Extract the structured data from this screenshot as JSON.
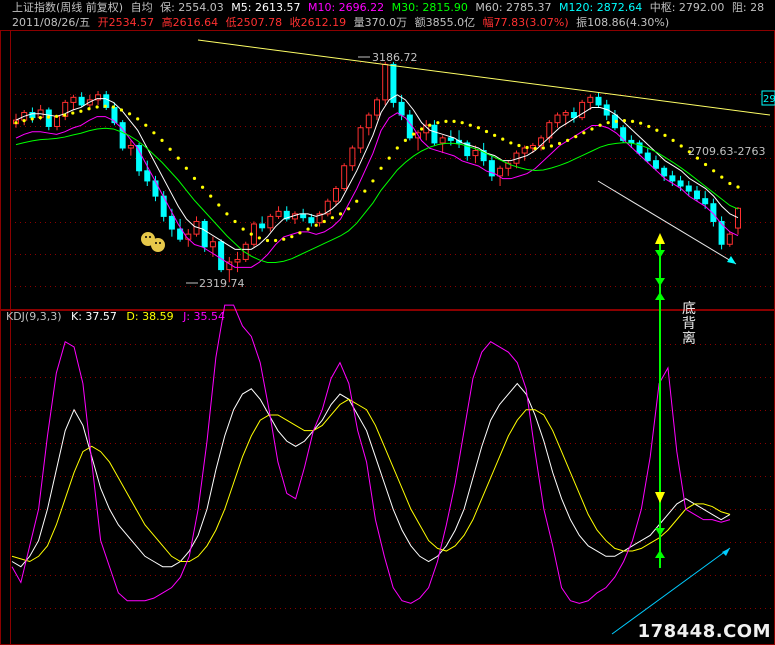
{
  "header": {
    "title": "上证指数(周线 前复权)",
    "avg_label": "自均",
    "bao": "保: 2554.03",
    "m5": "M5: 2613.57",
    "m10": "M10: 2696.22",
    "m30": "M30: 2815.90",
    "m60": "M60: 2785.37",
    "m120": "M120: 2872.64",
    "pivot": "中枢: 2792.00",
    "resist": "阻: 28",
    "date": "2011/08/26/五",
    "open": "开2534.57",
    "high": "高2616.64",
    "low": "低2507.78",
    "close": "收2612.19",
    "vol": "量370.0万",
    "amount": "额3855.0亿",
    "change": "幅77.83(3.07%)",
    "amplitude": "振108.86(4.30%)"
  },
  "kdj": {
    "title": "KDJ(9,3,3)",
    "k": "K: 37.57",
    "d": "D: 38.59",
    "j": "J: 35.54"
  },
  "annotations": {
    "high_label": "3186.72",
    "low_label": "2319.74",
    "right_label": "2709.63-2763",
    "edge_label": "29",
    "divergence": "底背离"
  },
  "watermark": "178448.COM",
  "colors": {
    "up": "#ff3030",
    "down": "#00ffff",
    "k": "#ffffff",
    "d": "#ffff00",
    "j": "#ff00ff",
    "grid": "#8b0000",
    "m5": "#ffffff",
    "m10": "#ffff00",
    "m30": "#ff00ff",
    "m60": "#00ff00"
  },
  "chart_data": [
    {
      "type": "candlestick",
      "title": "上证指数(周线 前复权)",
      "ylim": [
        2250,
        3300
      ],
      "candles": [
        [
          2946,
          2985,
          2930,
          2960
        ],
        [
          2960,
          3000,
          2940,
          2990
        ],
        [
          2990,
          3010,
          2950,
          2970
        ],
        [
          2970,
          3020,
          2960,
          3000
        ],
        [
          3000,
          3010,
          2920,
          2935
        ],
        [
          2935,
          2980,
          2920,
          2975
        ],
        [
          2975,
          3040,
          2960,
          3030
        ],
        [
          3030,
          3060,
          3000,
          3050
        ],
        [
          3050,
          3070,
          3010,
          3020
        ],
        [
          3020,
          3060,
          3000,
          3040
        ],
        [
          3040,
          3075,
          3020,
          3060
        ],
        [
          3060,
          3075,
          3000,
          3010
        ],
        [
          3010,
          3030,
          2940,
          2950
        ],
        [
          2950,
          2960,
          2840,
          2850
        ],
        [
          2850,
          2880,
          2820,
          2860
        ],
        [
          2860,
          2870,
          2740,
          2760
        ],
        [
          2760,
          2800,
          2700,
          2720
        ],
        [
          2720,
          2740,
          2640,
          2660
        ],
        [
          2660,
          2680,
          2560,
          2580
        ],
        [
          2580,
          2610,
          2500,
          2530
        ],
        [
          2530,
          2570,
          2480,
          2490
        ],
        [
          2490,
          2530,
          2460,
          2510
        ],
        [
          2510,
          2580,
          2500,
          2560
        ],
        [
          2560,
          2570,
          2440,
          2460
        ],
        [
          2460,
          2500,
          2420,
          2480
        ],
        [
          2480,
          2490,
          2360,
          2370
        ],
        [
          2370,
          2420,
          2320,
          2400
        ],
        [
          2400,
          2440,
          2360,
          2410
        ],
        [
          2410,
          2480,
          2400,
          2470
        ],
        [
          2470,
          2560,
          2460,
          2550
        ],
        [
          2550,
          2580,
          2520,
          2535
        ],
        [
          2535,
          2590,
          2520,
          2580
        ],
        [
          2580,
          2620,
          2570,
          2600
        ],
        [
          2600,
          2620,
          2560,
          2570
        ],
        [
          2570,
          2600,
          2550,
          2590
        ],
        [
          2590,
          2610,
          2560,
          2575
        ],
        [
          2575,
          2590,
          2540,
          2555
        ],
        [
          2555,
          2600,
          2540,
          2590
        ],
        [
          2590,
          2650,
          2580,
          2640
        ],
        [
          2640,
          2700,
          2620,
          2690
        ],
        [
          2690,
          2790,
          2680,
          2780
        ],
        [
          2780,
          2860,
          2760,
          2850
        ],
        [
          2850,
          2940,
          2830,
          2930
        ],
        [
          2930,
          2990,
          2900,
          2980
        ],
        [
          2980,
          3050,
          2960,
          3040
        ],
        [
          3040,
          3190,
          3020,
          3180
        ],
        [
          3180,
          3190,
          3010,
          3030
        ],
        [
          3030,
          3060,
          2960,
          2980
        ],
        [
          2980,
          3000,
          2880,
          2890
        ],
        [
          2890,
          2920,
          2840,
          2910
        ],
        [
          2910,
          2960,
          2880,
          2940
        ],
        [
          2940,
          2960,
          2860,
          2870
        ],
        [
          2870,
          2900,
          2830,
          2890
        ],
        [
          2890,
          2920,
          2860,
          2880
        ],
        [
          2880,
          2920,
          2850,
          2870
        ],
        [
          2870,
          2880,
          2800,
          2820
        ],
        [
          2820,
          2860,
          2790,
          2840
        ],
        [
          2840,
          2870,
          2780,
          2800
        ],
        [
          2800,
          2820,
          2720,
          2740
        ],
        [
          2740,
          2780,
          2700,
          2770
        ],
        [
          2770,
          2800,
          2740,
          2790
        ],
        [
          2790,
          2840,
          2770,
          2830
        ],
        [
          2830,
          2860,
          2800,
          2850
        ],
        [
          2850,
          2870,
          2830,
          2860
        ],
        [
          2860,
          2900,
          2840,
          2890
        ],
        [
          2890,
          2960,
          2870,
          2950
        ],
        [
          2950,
          2990,
          2930,
          2980
        ],
        [
          2980,
          3000,
          2940,
          2990
        ],
        [
          2990,
          3010,
          2950,
          2970
        ],
        [
          2970,
          3040,
          2960,
          3030
        ],
        [
          3030,
          3060,
          3000,
          3050
        ],
        [
          3050,
          3070,
          3010,
          3020
        ],
        [
          3020,
          3040,
          2960,
          2980
        ],
        [
          2980,
          3000,
          2920,
          2930
        ],
        [
          2930,
          2940,
          2870,
          2880
        ],
        [
          2880,
          2900,
          2850,
          2870
        ],
        [
          2870,
          2880,
          2820,
          2830
        ],
        [
          2830,
          2850,
          2790,
          2800
        ],
        [
          2800,
          2820,
          2760,
          2770
        ],
        [
          2770,
          2780,
          2720,
          2740
        ],
        [
          2740,
          2760,
          2700,
          2720
        ],
        [
          2720,
          2740,
          2680,
          2700
        ],
        [
          2700,
          2720,
          2660,
          2680
        ],
        [
          2680,
          2700,
          2640,
          2650
        ],
        [
          2650,
          2680,
          2610,
          2630
        ],
        [
          2630,
          2650,
          2540,
          2560
        ],
        [
          2560,
          2580,
          2450,
          2470
        ],
        [
          2470,
          2520,
          2460,
          2510
        ],
        [
          2534,
          2617,
          2508,
          2612
        ]
      ],
      "ma_series": [
        {
          "name": "M5",
          "values": [
            2960,
            2975,
            2985,
            2985,
            2980,
            2975,
            2985,
            3000,
            3010,
            3030,
            3045,
            3045,
            3030,
            3000,
            2960,
            2920,
            2860,
            2800,
            2740,
            2680,
            2620,
            2570,
            2540,
            2530,
            2510,
            2490,
            2470,
            2450,
            2450,
            2450,
            2470,
            2500,
            2540,
            2570,
            2580,
            2590,
            2590,
            2580,
            2590,
            2610,
            2640,
            2700,
            2760,
            2830,
            2900,
            2990,
            3040,
            3060,
            3040,
            3000,
            2950,
            2920,
            2910,
            2900,
            2890,
            2870,
            2860,
            2850,
            2830,
            2820,
            2800,
            2800,
            2810,
            2820,
            2840,
            2870,
            2900,
            2930,
            2950,
            2970,
            2990,
            3010,
            3010,
            3000,
            2980,
            2950,
            2920,
            2890,
            2860,
            2830,
            2800,
            2780,
            2760,
            2730,
            2710,
            2690,
            2660,
            2620,
            2590,
            2575
          ]
        },
        {
          "name": "M10",
          "values": [
            2950,
            2958,
            2965,
            2970,
            2972,
            2975,
            2980,
            2988,
            2995,
            3005,
            3012,
            3015,
            3012,
            3000,
            2985,
            2965,
            2940,
            2910,
            2880,
            2845,
            2810,
            2770,
            2730,
            2695,
            2660,
            2625,
            2590,
            2560,
            2530,
            2510,
            2495,
            2485,
            2485,
            2490,
            2500,
            2515,
            2530,
            2545,
            2560,
            2575,
            2590,
            2610,
            2640,
            2680,
            2720,
            2770,
            2810,
            2850,
            2880,
            2905,
            2925,
            2940,
            2950,
            2955,
            2955,
            2950,
            2940,
            2930,
            2915,
            2900,
            2885,
            2870,
            2860,
            2852,
            2848,
            2850,
            2858,
            2868,
            2880,
            2895,
            2910,
            2925,
            2940,
            2950,
            2955,
            2958,
            2955,
            2948,
            2935,
            2920,
            2900,
            2880,
            2858,
            2835,
            2810,
            2785,
            2760,
            2735,
            2710,
            2696
          ]
        }
      ]
    },
    {
      "type": "line",
      "title": "KDJ(9,3,3)",
      "ylim": [
        -10,
        110
      ],
      "series": [
        {
          "name": "K",
          "values": [
            20,
            18,
            22,
            28,
            40,
            55,
            70,
            78,
            72,
            60,
            48,
            40,
            34,
            30,
            26,
            22,
            20,
            18,
            18,
            20,
            24,
            30,
            40,
            55,
            68,
            78,
            84,
            86,
            82,
            76,
            70,
            66,
            64,
            66,
            70,
            74,
            80,
            84,
            82,
            76,
            70,
            60,
            50,
            40,
            32,
            26,
            22,
            20,
            22,
            26,
            32,
            40,
            52,
            64,
            74,
            80,
            84,
            88,
            84,
            76,
            66,
            54,
            44,
            36,
            30,
            26,
            24,
            22,
            22,
            24,
            26,
            28,
            30,
            34,
            38,
            42,
            44,
            42,
            40,
            38,
            36,
            38
          ]
        },
        {
          "name": "D",
          "values": [
            22,
            21,
            20,
            22,
            26,
            34,
            44,
            54,
            62,
            64,
            62,
            58,
            52,
            46,
            40,
            34,
            30,
            26,
            22,
            20,
            20,
            22,
            26,
            32,
            40,
            50,
            60,
            68,
            74,
            76,
            76,
            74,
            72,
            70,
            70,
            72,
            76,
            80,
            82,
            80,
            78,
            72,
            64,
            56,
            48,
            40,
            34,
            28,
            25,
            24,
            26,
            30,
            36,
            44,
            52,
            60,
            68,
            74,
            78,
            78,
            76,
            70,
            62,
            54,
            46,
            38,
            32,
            28,
            25,
            24,
            24,
            25,
            27,
            29,
            32,
            36,
            40,
            42,
            42,
            41,
            39,
            38
          ]
        },
        {
          "name": "J",
          "values": [
            18,
            12,
            26,
            40,
            68,
            92,
            104,
            102,
            88,
            58,
            28,
            18,
            8,
            5,
            5,
            5,
            6,
            8,
            10,
            14,
            22,
            40,
            66,
            98,
            118,
            118,
            110,
            106,
            96,
            78,
            58,
            46,
            44,
            56,
            70,
            78,
            90,
            96,
            88,
            70,
            58,
            36,
            22,
            10,
            5,
            4,
            6,
            10,
            20,
            34,
            50,
            70,
            90,
            100,
            104,
            102,
            100,
            96,
            86,
            62,
            40,
            26,
            10,
            5,
            4,
            5,
            8,
            10,
            14,
            20,
            28,
            40,
            60,
            88,
            94,
            62,
            40,
            38,
            36,
            36,
            35,
            36
          ]
        }
      ]
    }
  ]
}
